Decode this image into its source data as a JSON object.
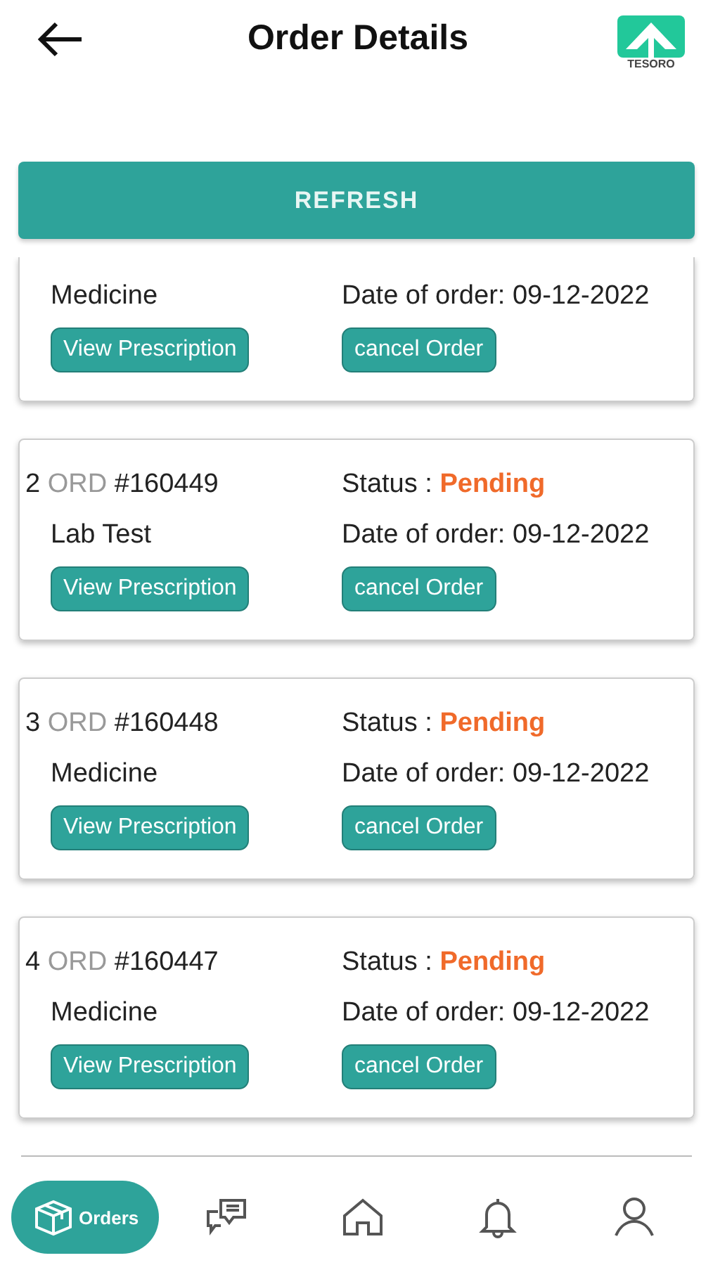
{
  "header": {
    "title": "Order Details",
    "logo_text": "TESORO"
  },
  "refresh_button": "REFRESH",
  "orders": [
    {
      "type": "Medicine",
      "date": "Date of order: 09-12-2022",
      "buttons": [
        "View Prescription",
        "cancel Order"
      ]
    },
    {
      "index": "2",
      "prefix": "ORD",
      "number": "#160449",
      "status_label": "Status :",
      "status": "Pending",
      "type": "Lab Test",
      "date": "Date of order: 09-12-2022",
      "buttons": [
        "View Prescription",
        "cancel Order"
      ]
    },
    {
      "index": "3",
      "prefix": "ORD",
      "number": "#160448",
      "status_label": "Status :",
      "status": "Pending",
      "type": "Medicine",
      "date": "Date of order: 09-12-2022",
      "buttons": [
        "View Prescription",
        "cancel Order"
      ]
    },
    {
      "index": "4",
      "prefix": "ORD",
      "number": "#160447",
      "status_label": "Status :",
      "status": "Pending",
      "type": "Medicine",
      "date": "Date of order: 09-12-2022",
      "buttons": [
        "View Prescription",
        "cancel Order"
      ]
    }
  ],
  "nav": [
    {
      "kind": "orders",
      "label": "Orders",
      "selected": true
    },
    {
      "kind": "chat",
      "selected": false
    },
    {
      "kind": "home",
      "selected": false
    },
    {
      "kind": "alerts",
      "selected": false
    },
    {
      "kind": "profile",
      "selected": false
    }
  ]
}
